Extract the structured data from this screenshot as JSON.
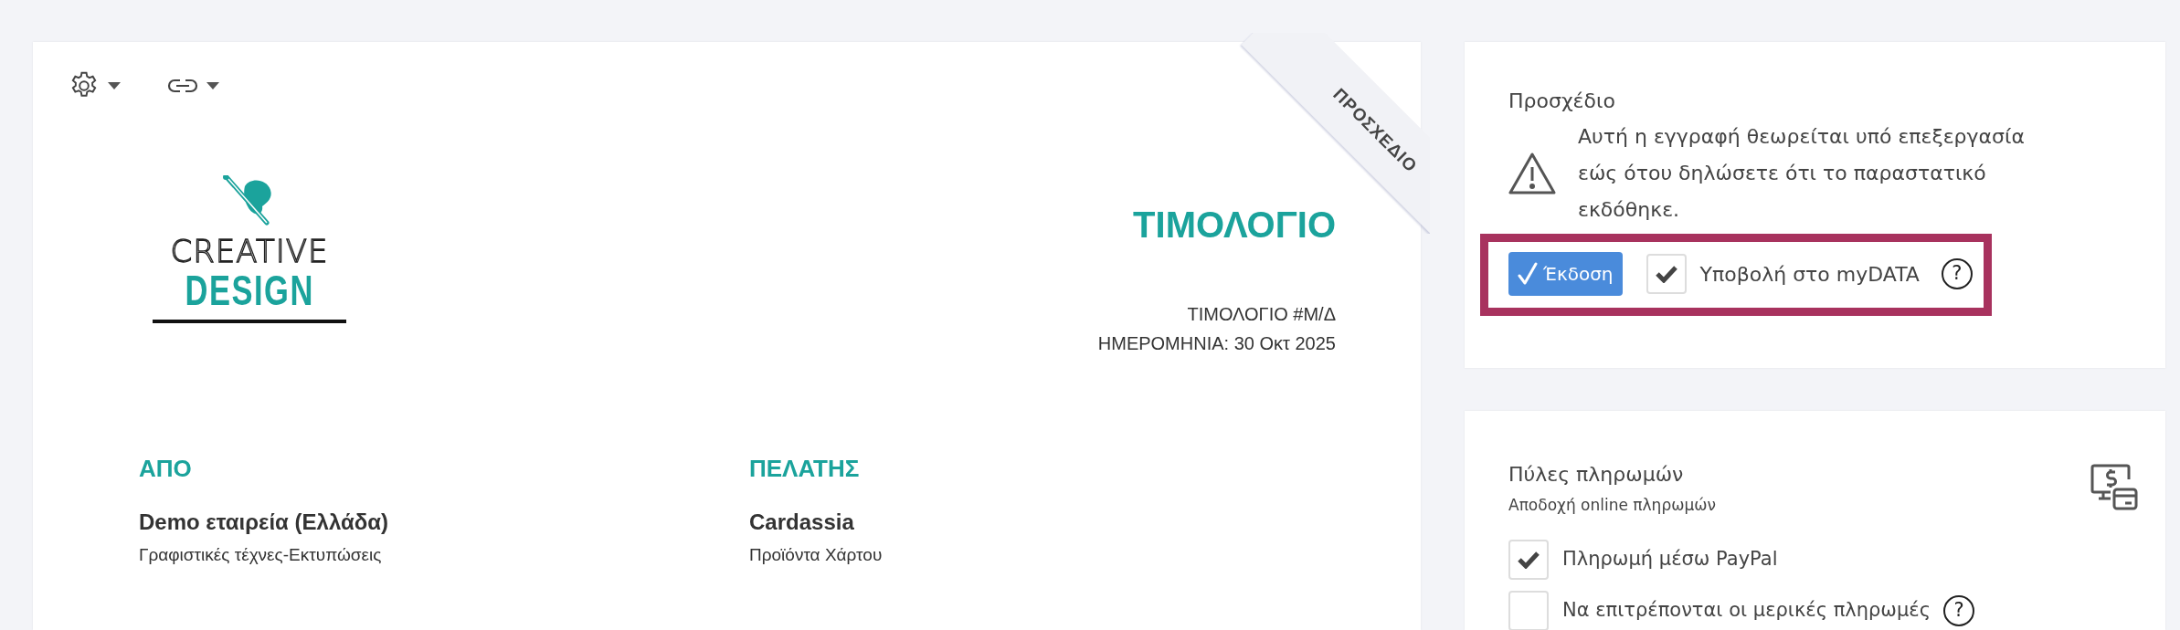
{
  "ribbon": "ΠΡΟΣΧΕΔΙΟ",
  "logo": {
    "line1": "CREATIVE",
    "line2": "DESIGN"
  },
  "invoice": {
    "title": "ΤΙΜΟΛΟΓΙΟ",
    "number": "ΤΙΜΟΛΟΓΙΟ #Μ/Δ",
    "date": "ΗΜΕΡΟΜΗΝΙΑ: 30 Οκτ 2025"
  },
  "parties": [
    {
      "heading": "ΑΠΟ",
      "name": "Demo εταιρεία (Ελλάδα)",
      "activity": "Γραφιστικές τέχνες-Εκτυπώσεις"
    },
    {
      "heading": "ΠΕΛΑΤΗΣ",
      "name": "Cardassia",
      "activity": "Προϊόντα Χάρτου"
    }
  ],
  "draft_panel": {
    "title": "Προσχέδιο",
    "message": "Αυτή η εγγραφή θεωρείται υπό επεξεργασία εώς ότου δηλώσετε ότι το παραστατικό εκδόθηκε.",
    "issue_button": "Έκδοση",
    "mydata": {
      "label": "Υποβολή στο myDATA",
      "checked": true,
      "help": "?"
    }
  },
  "payments": {
    "title": "Πύλες πληρωμών",
    "subtitle": "Αποδοχή online πληρωμών",
    "options": [
      {
        "label": "Πληρωμή μέσω PayPal",
        "checked": true
      },
      {
        "label": "Να επιτρέπονται οι μερικές πληρωμές",
        "checked": false,
        "help": "?"
      }
    ]
  }
}
